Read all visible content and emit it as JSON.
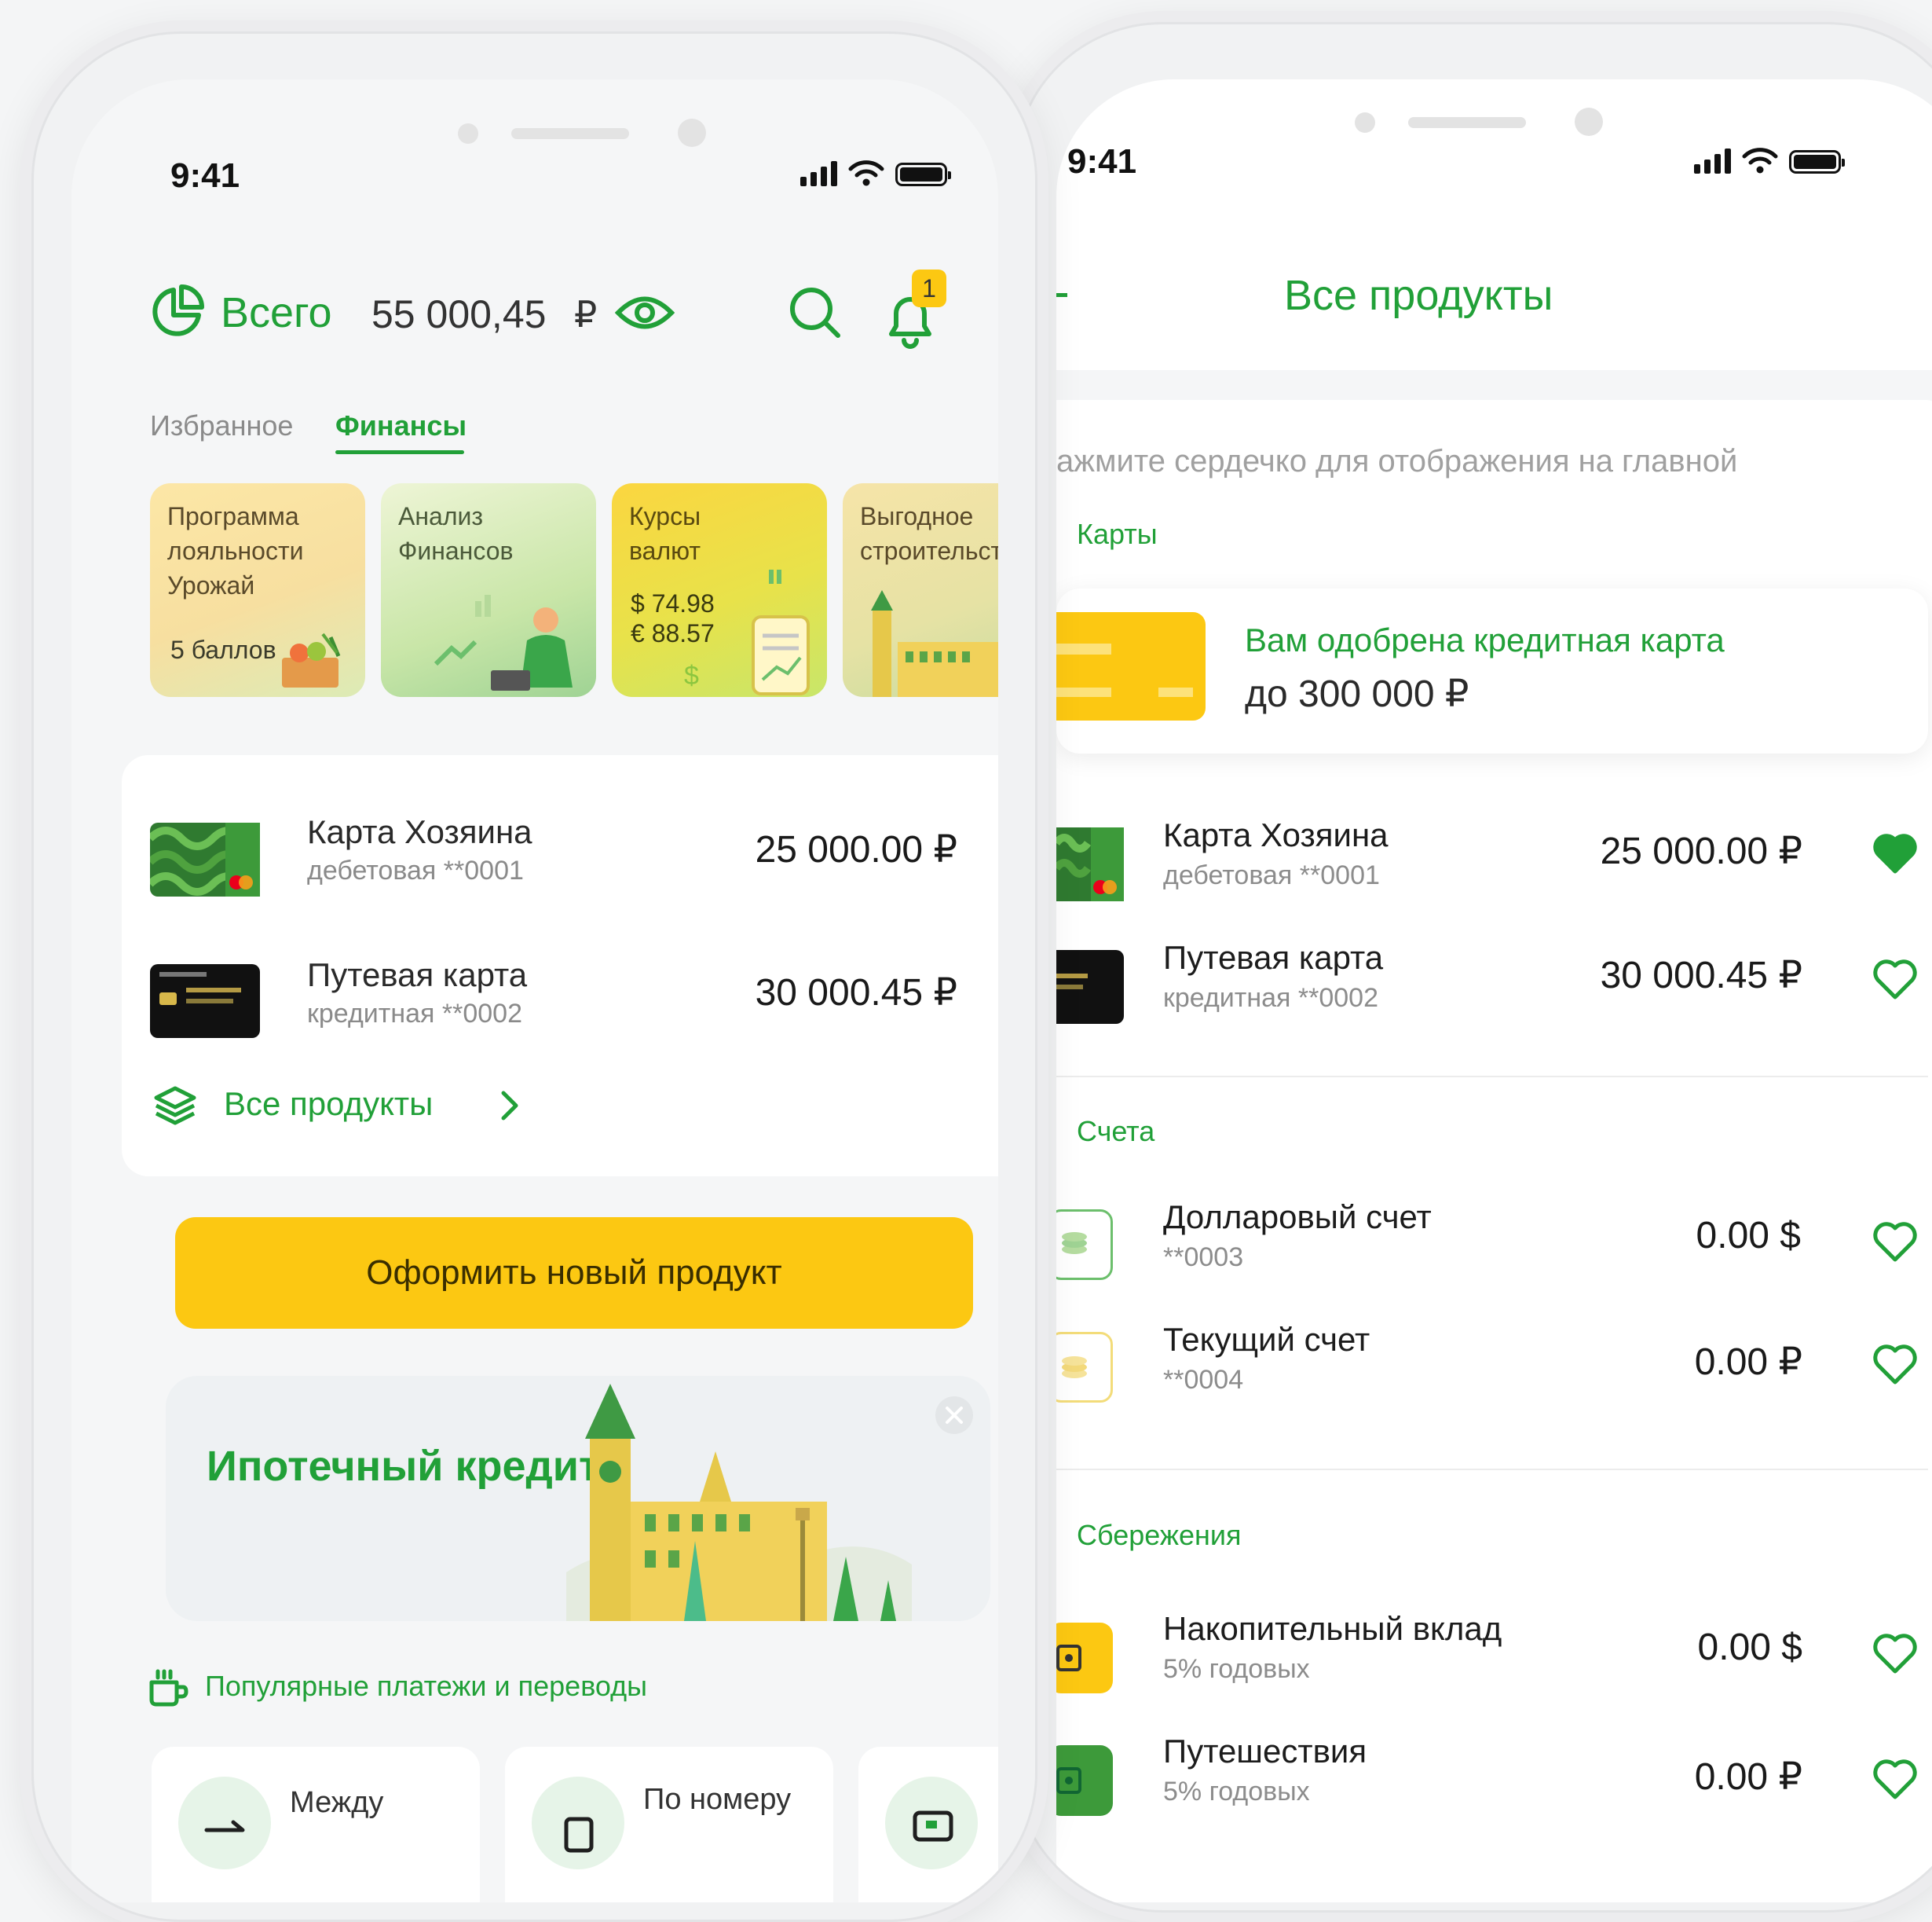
{
  "status_bar": {
    "time": "9:41"
  },
  "home": {
    "total_label": "Всего",
    "total_amount": "55 000,45",
    "currency": "₽",
    "notification_count": "1",
    "tabs": [
      {
        "label": "Избранное",
        "active": false
      },
      {
        "label": "Финансы",
        "active": true
      }
    ],
    "promos": [
      {
        "title": "Программа\nлояльности\nУрожай",
        "extra": "5 баллов"
      },
      {
        "title": "Анализ\nФинансов"
      },
      {
        "title": "Курсы\nвалют",
        "extra": "$ 74.98\n€ 88.57"
      },
      {
        "title": "Выгодное\nстроительст"
      }
    ],
    "products": [
      {
        "name": "Карта Хозяина",
        "sub": "дебетовая **0001",
        "amount": "25 000.00 ₽"
      },
      {
        "name": "Путевая  карта",
        "sub": "кредитная **0002",
        "amount": "30 000.45 ₽"
      }
    ],
    "all_products_link": "Все продукты",
    "new_product_button": "Оформить новый продукт",
    "mortgage_banner": "Ипотечный кредит",
    "popular_section": "Популярные платежи и переводы",
    "quick_actions": [
      {
        "label": "Между"
      },
      {
        "label": "По номеру"
      }
    ]
  },
  "all_products": {
    "title": "Все продукты",
    "hint": "ажмите сердечко для отображения на главной",
    "sections": {
      "cards": "Карты",
      "accounts": "Счета",
      "savings": "Сбережения"
    },
    "offer": {
      "line1": "Вам одобрена кредитная карта",
      "line2": "до 300 000 ₽"
    },
    "cards": [
      {
        "name": "Карта Хозяина",
        "sub": "дебетовая **0001",
        "amount": "25 000.00 ₽",
        "favorite": true
      },
      {
        "name": "Путевая  карта",
        "sub": "кредитная **0002",
        "amount": "30 000.45 ₽",
        "favorite": false
      }
    ],
    "accounts": [
      {
        "name": "Долларовый счет",
        "sub": "**0003",
        "amount": "0.00 $",
        "favorite": false
      },
      {
        "name": "Текущий счет",
        "sub": "**0004",
        "amount": "0.00 ₽",
        "favorite": false
      }
    ],
    "savings": [
      {
        "name": "Накопительный вклад",
        "sub": "5% годовых",
        "amount": "0.00 $",
        "favorite": false
      },
      {
        "name": "Путешествия",
        "sub": "5% годовых",
        "amount": "0.00 ₽",
        "favorite": false
      }
    ]
  },
  "colors": {
    "brand_green": "#21a038",
    "accent_yellow": "#fcc812"
  }
}
